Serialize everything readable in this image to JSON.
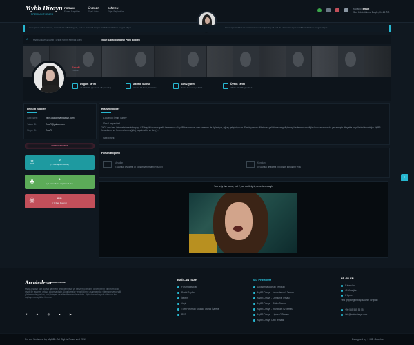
{
  "header": {
    "logo": "Mybb Dizayn",
    "logo_sub": "PREMIUM THEMES",
    "nav": [
      {
        "label": "FORUM",
        "sub": "Forum Başlıkları"
      },
      {
        "label": "ÜYELER",
        "sub": "Üye Listesi"
      },
      {
        "label": "DİĞER ▾",
        "sub": "Diğer Bağlantılar"
      }
    ],
    "user": {
      "label": "Kullanıcı",
      "name": "ErkuR",
      "last": "Son Görüntüleme Bugün, 04:25 ÖÖ"
    }
  },
  "notice": {
    "left": "Lorem ipsum dolor sit amet, consectetur adipiscing elit, sed do eiusmod tempor incididunt ut labore magna aliqua.",
    "right": "Lorem ipsum dolor sit amet consectetur adipiscing elit sed do eiusmod tempor incididunt ut labore magna aliqua."
  },
  "breadcrumb": {
    "home": "Mybb Dizayn & Mybb Türkçe Forum Kaynak Sitesi",
    "current": "ErkuR Adlı Kullanıcının Profil Bilgileri"
  },
  "profile": {
    "username": "ErkuR",
    "usertitle": "Yönetici",
    "stats": [
      {
        "title": "Doğum Tarihi",
        "value": "29-08-1996 (Şu anda 25 yaşında)"
      },
      {
        "title": "Aktiflik Süresi",
        "value": "2 Gün, 16 Saat, 3 Dakika"
      },
      {
        "title": "Son Ziyareti",
        "value": "Başka Kullanıcıya Saklı"
      },
      {
        "title": "Üyelik Tarihi",
        "value": "26-06-2019 Bugün 10:14"
      }
    ]
  },
  "contact": {
    "title": "İletişim Bilgileri",
    "rows": [
      {
        "k": "Web Sitesi:",
        "v": "https://www.mybbdizayn.com/"
      },
      {
        "k": "Yahoo ID:",
        "v": "ErkuR@yahoo.com"
      },
      {
        "k": "Skype ID:",
        "v": "ErkuR"
      }
    ],
    "badge": "ADMINISTRATOR"
  },
  "cards": [
    {
      "num": "0",
      "label": "( 0 Mesaj Gönderdi )",
      "color": "#1e9aa0"
    },
    {
      "num": "1",
      "label": "( 1 Konu Açtı - Toplamı 0 % )",
      "color": "#5cab58"
    },
    {
      "num": "0 %",
      "label": "( 0 Rep Puanı )",
      "color": "#c24f5a"
    }
  ],
  "personal": {
    "title": "Kişisel Bilgiler",
    "location": "Lokasyon: İzmir, Turkey",
    "sex": "Sex: Unspecified",
    "bio": "2007 den beri internet sitelerinde php, CS büyük tasarım grafik tasarımcısı. MyBB tasarımı ve web tasarımı ile ilgileniyor, uğraş geliştiriyorum. Farklı yazılım dillerinde, geliştirme ve geliştirmeyi ilerlemeni sevdiğim konular arasında yer almıştır. Hayatta hayallerimi insanlığın MyBB forumlarını ve forum ortamını(gibi) yaşatmaktır ve dei (…)",
    "sex2": "Sex: Erkek"
  },
  "forum_info": {
    "title": "Forum Bilgileri",
    "a_title": "Mesajlar",
    "a_text": "0 (Günlük ortalama 0) Toplam yorumlamı (%0.00)",
    "b_title": "Konuları",
    "b_text": "0 (Günlük ortalama 0) Toplam konuların 0%0"
  },
  "video": {
    "caption": "You only live once, but if you do it right, once is enough."
  },
  "footer": {
    "brand": "Arcobaleno",
    "brand_sub": "DARK FORUM",
    "about": "MyBB Dizayn tüm dünya da mybb ile ilgilenmeye ve benzeri içeriklere değer veren bir forum olup, mybb ile tasarımı ortaya çıkarmaktadır. Uygulamalar ve geliştirme aşamasında; sitemizde ve çeşitli yöntemlerde yazılım, kod, bileşen ve eklentiler sunulmaktadır. Mybb forum kaynak sitesi ve kod sağlayıcı kolaylıklar forumu.",
    "links_title": "BAĞLANTILAR",
    "links": [
      "Forum Başlıkları",
      "Portal Sayfası",
      "İletişim",
      "Arşiv",
      "Tüm Forumları Okundu Olarak İşaretle",
      "RSS"
    ],
    "premium_title": "MD PREMIUM",
    "premium": [
      "Dolaştırma Ajanları Temaları",
      "MyBB Dizayn - Arcobaleno v2 Teması",
      "MyBB Dizayn - Crimsone Teması",
      "MyBB Dizayn - Rivitto Teması",
      "MyBB Dizayn - Revoleum v2 Teması",
      "MyBB Dizayn - Lignia v2 Teması",
      "MyBB Dizayn Özel Temalar"
    ],
    "info_title": "BİLGİLER",
    "info": [
      "8 Konuları",
      "40 Mesajları",
      "6 Üyeler",
      "Yeni gruplar gün başı kalanın Grupları"
    ],
    "phone": "+90 555 555 55 55",
    "mail": "info@mybbdizayn.com"
  },
  "bottom": {
    "left": "Forum Software by MyBB - All Rights Reserved 2019",
    "right": "Designed by ♥ MD Graphic"
  }
}
